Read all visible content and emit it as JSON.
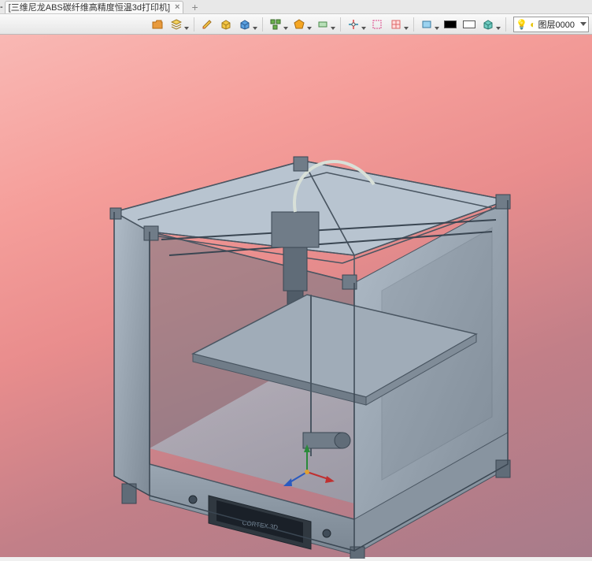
{
  "tabs": {
    "prefix": "- ",
    "title": "[三维尼龙ABS碳纤维高精度恒温3d打印机]"
  },
  "toolbar": {
    "icons": [
      {
        "name": "folder-open-icon"
      },
      {
        "name": "layers-stack-icon"
      },
      {
        "name": "pencil-icon"
      },
      {
        "name": "box-yellow-icon"
      },
      {
        "name": "box-blue-icon"
      },
      {
        "name": "assembly-icon"
      },
      {
        "name": "polygon-icon"
      },
      {
        "name": "plane-icon"
      },
      {
        "name": "axis-icon"
      },
      {
        "name": "select-icon"
      },
      {
        "name": "grid-icon"
      },
      {
        "name": "view-icon"
      },
      {
        "name": "fill-black-icon"
      },
      {
        "name": "fill-white-icon"
      },
      {
        "name": "box-teal-icon"
      }
    ]
  },
  "layer": {
    "label": "图层0000"
  },
  "model": {
    "panel_label": "CORTEX 3D"
  }
}
